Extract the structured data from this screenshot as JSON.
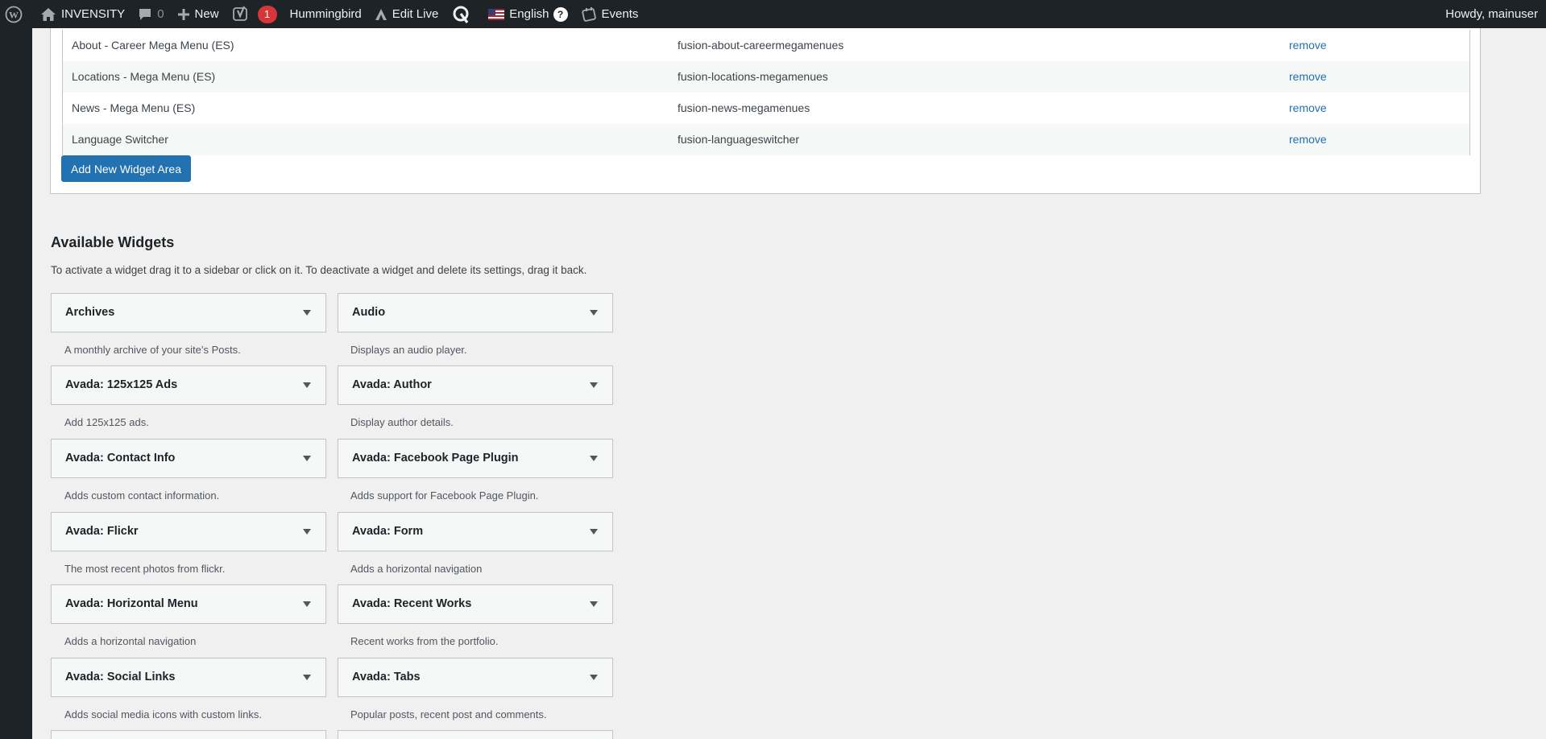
{
  "admin_bar": {
    "site_name": "INVENSITY",
    "comments_count": "0",
    "new_label": "New",
    "yoast_badge": "1",
    "hummingbird_label": "Hummingbird",
    "edit_live_label": "Edit Live",
    "language_label": "English",
    "language_help": "?",
    "events_label": "Events",
    "howdy": "Howdy, mainuser"
  },
  "widget_areas": {
    "rows": [
      {
        "name": "About - Career Mega Menu (ES)",
        "id": "fusion-about-careermegamenues",
        "action": "remove"
      },
      {
        "name": "Locations - Mega Menu (ES)",
        "id": "fusion-locations-megamenues",
        "action": "remove"
      },
      {
        "name": "News - Mega Menu (ES)",
        "id": "fusion-news-megamenues",
        "action": "remove"
      },
      {
        "name": "Language Switcher",
        "id": "fusion-languageswitcher",
        "action": "remove"
      }
    ],
    "add_button": "Add New Widget Area"
  },
  "available_widgets": {
    "title": "Available Widgets",
    "description": "To activate a widget drag it to a sidebar or click on it. To deactivate a widget and delete its settings, drag it back.",
    "items": [
      {
        "title": "Archives",
        "desc": "A monthly archive of your site’s Posts."
      },
      {
        "title": "Audio",
        "desc": "Displays an audio player."
      },
      {
        "title": "Avada: 125x125 Ads",
        "desc": "Add 125x125 ads."
      },
      {
        "title": "Avada: Author",
        "desc": "Display author details."
      },
      {
        "title": "Avada: Contact Info",
        "desc": "Adds custom contact information."
      },
      {
        "title": "Avada: Facebook Page Plugin",
        "desc": "Adds support for Facebook Page Plugin."
      },
      {
        "title": "Avada: Flickr",
        "desc": "The most recent photos from flickr."
      },
      {
        "title": "Avada: Form",
        "desc": "Adds a horizontal navigation"
      },
      {
        "title": "Avada: Horizontal Menu",
        "desc": "Adds a horizontal navigation"
      },
      {
        "title": "Avada: Recent Works",
        "desc": "Recent works from the portfolio."
      },
      {
        "title": "Avada: Social Links",
        "desc": "Adds social media icons with custom links."
      },
      {
        "title": "Avada: Tabs",
        "desc": "Popular posts, recent post and comments."
      }
    ]
  },
  "colors": {
    "admin_bar_bg": "#1d2327",
    "link": "#2271b1",
    "badge": "#d63638",
    "page_bg": "#f0f0f1"
  }
}
